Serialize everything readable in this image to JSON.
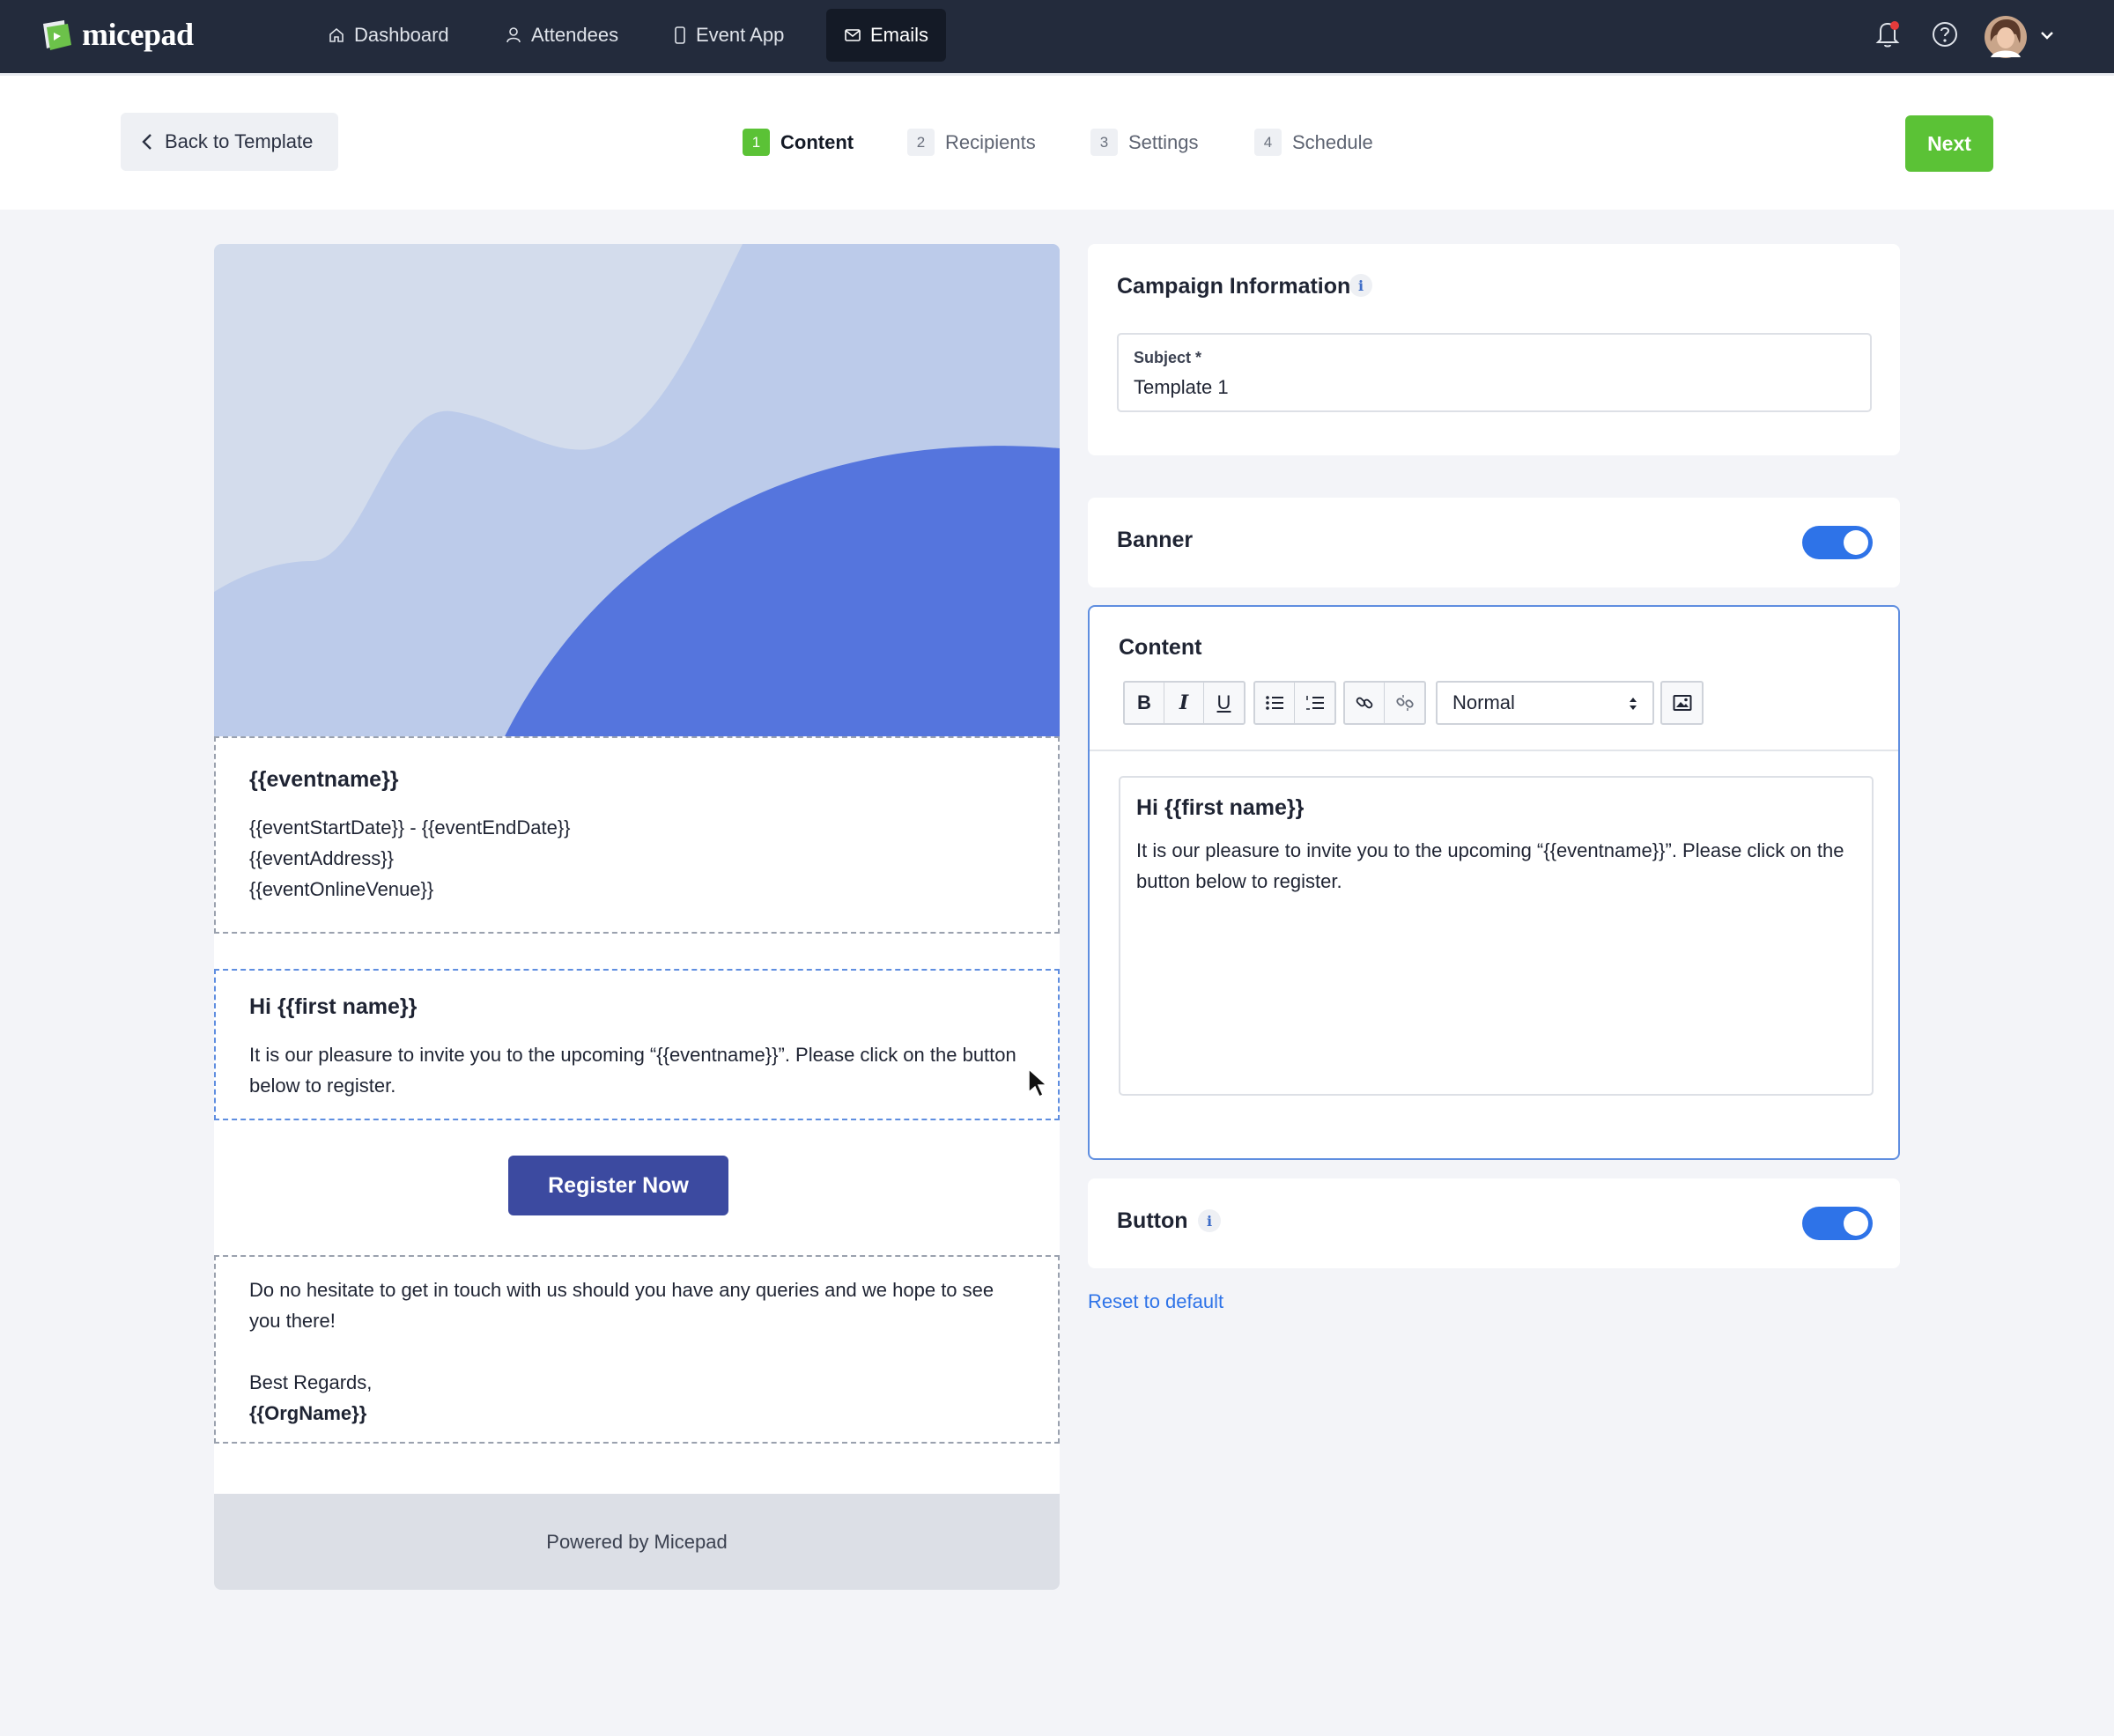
{
  "app": {
    "name": "micepad"
  },
  "nav": {
    "items": [
      {
        "label": "Dashboard",
        "icon": "home-icon"
      },
      {
        "label": "Attendees",
        "icon": "user-icon"
      },
      {
        "label": "Event App",
        "icon": "phone-icon"
      },
      {
        "label": "Emails",
        "icon": "mail-icon",
        "active": true
      }
    ]
  },
  "stepbar": {
    "back_label": "Back to Template",
    "steps": [
      {
        "num": "1",
        "label": "Content",
        "active": true
      },
      {
        "num": "2",
        "label": "Recipients"
      },
      {
        "num": "3",
        "label": "Settings"
      },
      {
        "num": "4",
        "label": "Schedule"
      }
    ],
    "next_label": "Next"
  },
  "preview": {
    "event_title": "{{eventname}}",
    "event_dates": "{{eventStartDate}} - {{eventEndDate}}",
    "event_address": "{{eventAddress}}",
    "event_online": "{{eventOnlineVenue}}",
    "greeting": "Hi {{first name}}",
    "body": "It is our pleasure to invite you to the upcoming “{{eventname}}”. Please click on the button below to register.",
    "button_label": "Register Now",
    "closing": "Do no hesitate to get in touch with us should you have any queries and we hope to see you there!",
    "regards": "Best Regards,",
    "org": "{{OrgName}}",
    "footer": "Powered by Micepad"
  },
  "campaign": {
    "title": "Campaign Information",
    "subject_label": "Subject *",
    "subject_value": "Template 1"
  },
  "banner_card": {
    "title": "Banner",
    "enabled": true
  },
  "content_card": {
    "title": "Content",
    "format_value": "Normal",
    "editor_title": "Hi {{first name}}",
    "editor_body": "It is our pleasure to invite you to the upcoming “{{eventname}}”. Please click on the button below to register."
  },
  "button_card": {
    "title": "Button",
    "enabled": true
  },
  "reset_label": "Reset to default",
  "colors": {
    "nav_bg": "#232b3c",
    "accent_green": "#5bc236",
    "accent_blue": "#2e73e8",
    "button_indigo": "#3c4aa0"
  }
}
